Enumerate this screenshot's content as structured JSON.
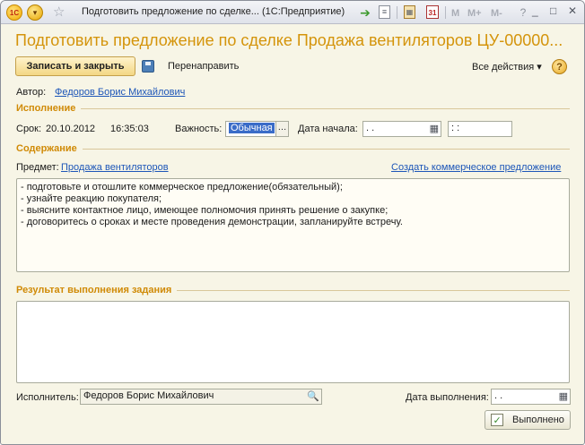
{
  "titlebar": {
    "logo": "1C",
    "title": "Подготовить предложение по сделке... (1С:Предприятие)",
    "calendar_num": "31",
    "m_buttons": [
      "M",
      "M+",
      "M-"
    ],
    "help": "?",
    "controls": [
      "_",
      "□",
      "✕"
    ],
    "icons": [
      "app-logo-icon",
      "main-menu-icon",
      "favorite-star-icon",
      "go-arrow-icon",
      "document-icon",
      "calculator-icon",
      "calendar-icon"
    ]
  },
  "form": {
    "title": "Подготовить предложение по сделке Продажа вентиляторов ЦУ-00000...",
    "toolbar": {
      "save_close": "Записать и закрыть",
      "redirect": "Перенаправить",
      "all_actions": "Все действия ▾",
      "help": "?"
    },
    "author_label": "Автор:",
    "author_value": "Федоров Борис Михайлович",
    "execution": {
      "header": "Исполнение",
      "deadline_label": "Срок:",
      "deadline_date": "20.10.2012",
      "deadline_time": "16:35:03",
      "importance_label": "Важность:",
      "importance_value": "Обычная",
      "start_label": "Дата начала:",
      "start_date": " .  .",
      "start_time": " :  :"
    },
    "content": {
      "header": "Содержание",
      "subject_label": "Предмет:",
      "subject_value": "Продажа вентиляторов",
      "create_offer_link": "Создать коммерческое предложение",
      "lines": [
        "- подготовьте и отошлите коммерческое предложение(обязательный);",
        "- узнайте реакцию покупателя;",
        "- выясните контактное лицо, имеющее полномочия принять решение о закупке;",
        "- договоритесь о сроках и месте проведения демонстрации, запланируйте встречу."
      ]
    },
    "result": {
      "header": "Результат выполнения задания",
      "text": ""
    },
    "executor_label": "Исполнитель:",
    "executor_value": "Федоров Борис Михайлович",
    "done_date_label": "Дата выполнения:",
    "done_date_value": " .  .",
    "done_button": "Выполнено"
  },
  "colors": {
    "accent": "#d4940b",
    "section": "#d08a06",
    "link": "#1d56b8",
    "background": "#f7f5e6",
    "selection": "#3a6cc8"
  }
}
